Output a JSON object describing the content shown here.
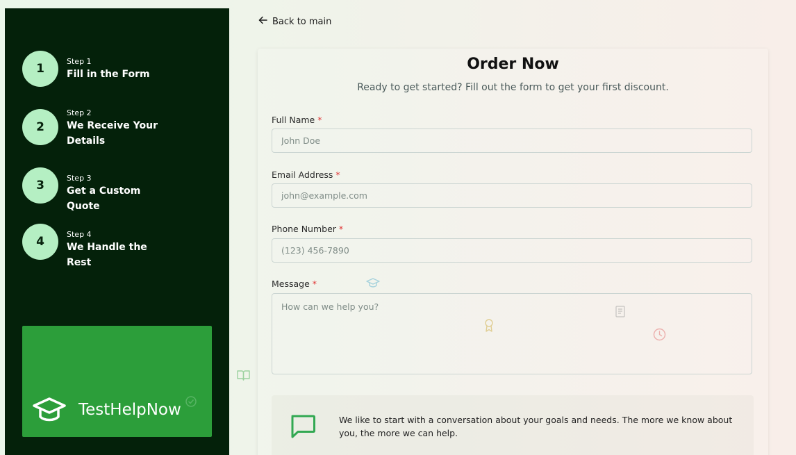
{
  "sidebar": {
    "steps": [
      {
        "number": "1",
        "kicker": "Step 1",
        "title": "Fill in the Form"
      },
      {
        "number": "2",
        "kicker": "Step 2",
        "title": "We Receive Your Details"
      },
      {
        "number": "3",
        "kicker": "Step 3",
        "title": "Get a Custom Quote"
      },
      {
        "number": "4",
        "kicker": "Step 4",
        "title": "We Handle the Rest"
      }
    ],
    "brand_name": "TestHelpNow"
  },
  "back_link": "Back to main",
  "form": {
    "title": "Order Now",
    "subtitle": "Ready to get started? Fill out the form to get your first discount.",
    "required_mark": "*",
    "fields": {
      "full_name": {
        "label": "Full Name",
        "placeholder": "John Doe"
      },
      "email": {
        "label": "Email Address",
        "placeholder": "john@example.com"
      },
      "phone": {
        "label": "Phone Number",
        "placeholder": "(123) 456-7890"
      },
      "message": {
        "label": "Message",
        "placeholder": "How can we help you?"
      }
    },
    "info_text": "We like to start with a conversation about your goals and needs. The more we know about you, the more we can help."
  },
  "colors": {
    "sidebar_bg": "#04210a",
    "step_circle": "#b5efc3",
    "brand_green": "#2c9e3a",
    "required": "#e03131"
  },
  "icons": {
    "back": "arrow-left-icon",
    "brand": "graduation-cap-icon",
    "info": "chat-bubble-icon",
    "decor": [
      "graduation-cap-icon",
      "award-icon",
      "notepad-icon",
      "clock-icon",
      "book-icon",
      "check-circle-icon"
    ]
  }
}
